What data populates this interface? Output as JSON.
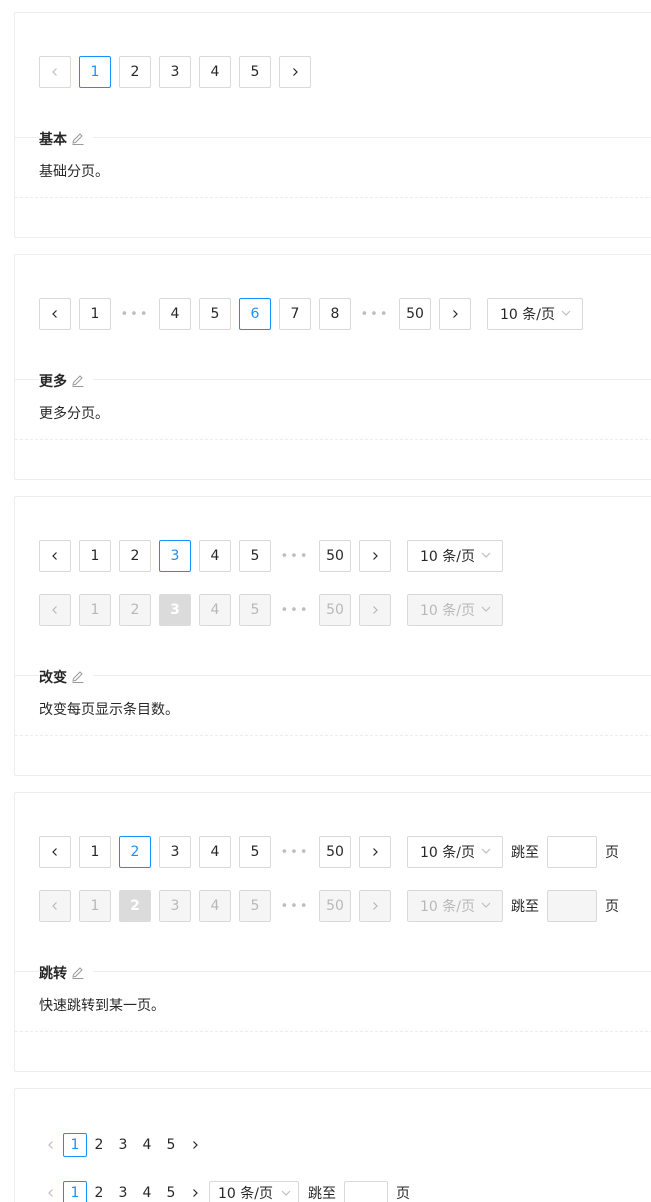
{
  "pager": {
    "prev_icon": "left-arrow-icon",
    "next_icon": "right-arrow-icon",
    "ellipsis": "•••",
    "size_changer": "10 条/页",
    "jump_label": "跳至",
    "jump_suffix": "页"
  },
  "basic": {
    "pages": [
      "1",
      "2",
      "3",
      "4",
      "5"
    ],
    "active": "1",
    "title": "基本",
    "description": "基础分页。"
  },
  "more": {
    "pages": [
      "1",
      "4",
      "5",
      "6",
      "7",
      "8",
      "50"
    ],
    "active": "6",
    "title": "更多",
    "description": "更多分页。"
  },
  "changer": {
    "pages": [
      "1",
      "2",
      "3",
      "4",
      "5",
      "50"
    ],
    "active": "3",
    "title": "改变",
    "description": "改变每页显示条目数。"
  },
  "jumper": {
    "pages": [
      "1",
      "2",
      "3",
      "4",
      "5",
      "50"
    ],
    "active": "2",
    "title": "跳转",
    "description": "快速跳转到某一页。"
  },
  "mini": {
    "pages": [
      "1",
      "2",
      "3",
      "4",
      "5"
    ],
    "active": "1"
  },
  "colors": {
    "primary": "#1890ff",
    "border": "#d9d9d9",
    "disabled_bg": "#f5f5f5"
  }
}
